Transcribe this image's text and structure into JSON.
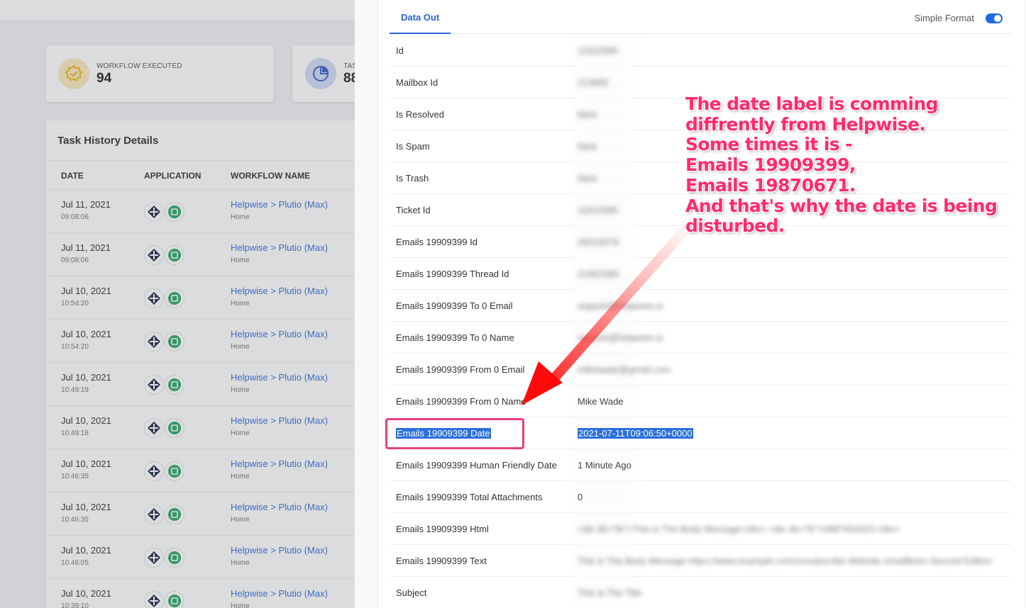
{
  "background": {
    "stats": [
      {
        "label": "WORKFLOW EXECUTED",
        "value": "94",
        "icon": "badge-check-icon",
        "color": "#f5b800"
      },
      {
        "label": "TAS",
        "value": "88",
        "icon": "pie-chart-icon",
        "color": "#3b63c7"
      }
    ],
    "history": {
      "title": "Task History Details",
      "columns": [
        "DATE",
        "APPLICATION",
        "WORKFLOW NAME"
      ],
      "rows": [
        {
          "date": "Jul 11, 2021",
          "time": "09:08:06",
          "workflow": "Helpwise > Plutio (Max)",
          "folder": "Home"
        },
        {
          "date": "Jul 11, 2021",
          "time": "09:08:06",
          "workflow": "Helpwise > Plutio (Max)",
          "folder": "Home"
        },
        {
          "date": "Jul 10, 2021",
          "time": "10:54:20",
          "workflow": "Helpwise > Plutio (Max)",
          "folder": "Home"
        },
        {
          "date": "Jul 10, 2021",
          "time": "10:54:20",
          "workflow": "Helpwise > Plutio (Max)",
          "folder": "Home"
        },
        {
          "date": "Jul 10, 2021",
          "time": "10:49:19",
          "workflow": "Helpwise > Plutio (Max)",
          "folder": "Home"
        },
        {
          "date": "Jul 10, 2021",
          "time": "10:49:18",
          "workflow": "Helpwise > Plutio (Max)",
          "folder": "Home"
        },
        {
          "date": "Jul 10, 2021",
          "time": "10:46:35",
          "workflow": "Helpwise > Plutio (Max)",
          "folder": "Home"
        },
        {
          "date": "Jul 10, 2021",
          "time": "10:46:35",
          "workflow": "Helpwise > Plutio (Max)",
          "folder": "Home"
        },
        {
          "date": "Jul 10, 2021",
          "time": "10:46:05",
          "workflow": "Helpwise > Plutio (Max)",
          "folder": "Home"
        },
        {
          "date": "Jul 10, 2021",
          "time": "10:39:10",
          "workflow": "Helpwise > Plutio (Max)",
          "folder": "Home"
        }
      ]
    }
  },
  "drawer": {
    "tab": "Data Out",
    "simple_format_label": "Simple Format",
    "simple_format_on": true,
    "fields": [
      {
        "key": "Id",
        "value": "11912080",
        "blurred": true
      },
      {
        "key": "Mailbox Id",
        "value": "213865",
        "blurred": true
      },
      {
        "key": "Is Resolved",
        "value": "false",
        "blurred": true
      },
      {
        "key": "Is Spam",
        "value": "false",
        "blurred": true
      },
      {
        "key": "Is Trash",
        "value": "false",
        "blurred": true
      },
      {
        "key": "Ticket Id",
        "value": "11912080",
        "blurred": true
      },
      {
        "key": "Emails 19909399 Id",
        "value": "26019376",
        "blurred": true
      },
      {
        "key": "Emails 19909399 Thread Id",
        "value": "21901580",
        "blurred": true
      },
      {
        "key": "Emails 19909399 To 0 Email",
        "value": "support@helpwise.io",
        "blurred": true
      },
      {
        "key": "Emails 19909399 To 0 Name",
        "value": "support@helpwise.io",
        "blurred": true
      },
      {
        "key": "Emails 19909399 From 0 Email",
        "value": "mikewade@gmail.com",
        "blurred": true
      },
      {
        "key": "Emails 19909399 From 0 Name",
        "value": "Mike Wade",
        "blurred": false
      },
      {
        "key": "Emails 19909399 Date",
        "value": "2021-07-11T09:06:50+0000",
        "blurred": false,
        "selected": true
      },
      {
        "key": "Emails 19909399 Human Friendly Date",
        "value": "1 Minute Ago",
        "blurred": false
      },
      {
        "key": "Emails 19909399 Total Attachments",
        "value": "0",
        "blurred": false
      },
      {
        "key": "Emails 19909399 Html",
        "value": "<div dir=\"ltr\">This is The Body Message</div> <div dir=\"ltr\">0987654321</div>",
        "blurred": true
      },
      {
        "key": "Emails 19909399 Text",
        "value": "This is The Body Message https://www.example.com/unsubscribe Website emailBeen Second Edition",
        "blurred": true
      },
      {
        "key": "Subject",
        "value": "This is The Title",
        "blurred": true
      }
    ]
  },
  "annotation": {
    "lines": [
      "The date label is comming",
      "diffrently from Helpwise.",
      "Some times it is -",
      "Emails 19909399,",
      "Emails 19870671.",
      "And that's why the date is being",
      "disturbed."
    ],
    "color": "#ff2a6d"
  }
}
